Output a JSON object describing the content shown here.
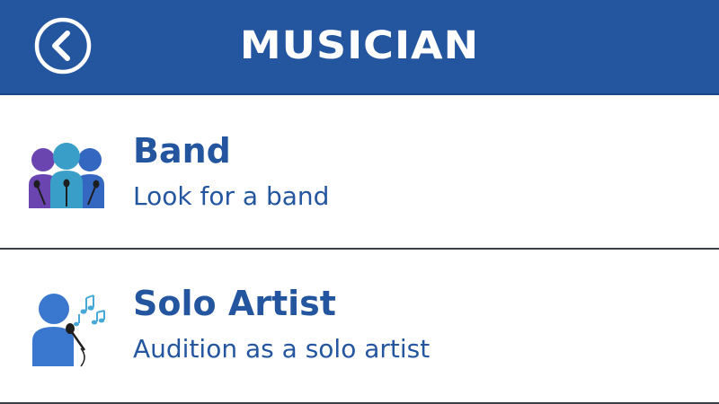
{
  "header": {
    "title": "MUSICIAN",
    "back_icon": "back-arrow-circle-icon",
    "background_color": "#2456a0"
  },
  "options": [
    {
      "title": "Band",
      "subtitle": "Look for a band",
      "icon": "band-members-icon"
    },
    {
      "title": "Solo Artist",
      "subtitle": "Audition as a solo artist",
      "icon": "solo-singer-icon"
    }
  ],
  "colors": {
    "accent": "#2456a0",
    "band_purple": "#6a45b0",
    "band_teal": "#3a9fc8",
    "band_blue": "#3468c0",
    "solo_blue": "#3a78d0",
    "divider": "#3a3f45"
  }
}
